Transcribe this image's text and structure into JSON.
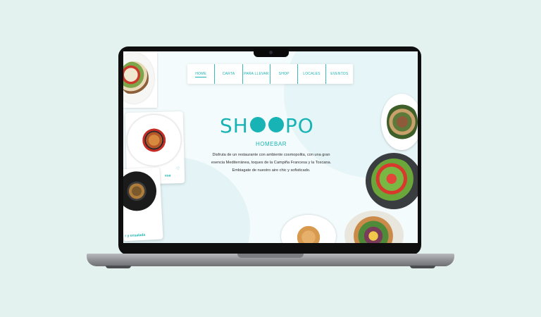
{
  "nav": {
    "items": [
      {
        "label": "HOME",
        "active": true
      },
      {
        "label": "CARTA",
        "active": false
      },
      {
        "label": "PARA LLEVAR",
        "active": false
      },
      {
        "label": "SHOP",
        "active": false
      },
      {
        "label": "LOCALES",
        "active": false
      },
      {
        "label": "EVENTOS",
        "active": false
      }
    ]
  },
  "hero": {
    "logo_pre": "SH",
    "logo_post": "PO",
    "subtitle": "HOMEBAR",
    "description_lines": [
      "Disfruta de un restaurante con ambiente cosmopolita, con una gran",
      "esencia Mediterránea, toques de la Campiña Francesa y la Toscana.",
      "Embiagate de nuestro aire chic y sofisticado."
    ]
  },
  "cards": {
    "middle_tag": "esa",
    "bottom_tag": "r y ensalada"
  },
  "colors": {
    "brand": "#17b3b5",
    "background": "#e3f1ef",
    "screen": "#f4fbfc"
  }
}
